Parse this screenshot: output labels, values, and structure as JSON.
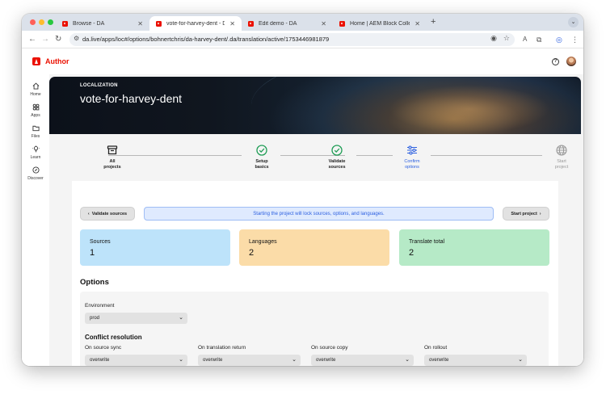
{
  "browser": {
    "tabs": [
      {
        "label": "Browse - DA",
        "active": false
      },
      {
        "label": "vote-for-harvey-dent - DA Tr",
        "active": true
      },
      {
        "label": "Edit demo - DA",
        "active": false
      },
      {
        "label": "Home | AEM Block Collection",
        "active": false
      }
    ],
    "url": "da.live/apps/loc#/options/bohnertchris/da-harvey-dent/.da/translation/active/1753446981879",
    "traffic_colors": [
      "#ff5f57",
      "#febc2e",
      "#28c840"
    ]
  },
  "app": {
    "name": "Author",
    "brand_color": "#eb1000"
  },
  "rail": {
    "items": [
      {
        "label": "Home",
        "icon": "home-icon"
      },
      {
        "label": "Apps",
        "icon": "apps-icon"
      },
      {
        "label": "Files",
        "icon": "folder-icon"
      },
      {
        "label": "Learn",
        "icon": "lightbulb-icon"
      },
      {
        "label": "Discover",
        "icon": "compass-icon"
      }
    ]
  },
  "hero": {
    "kicker": "LOCALIZATION",
    "title": "vote-for-harvey-dent"
  },
  "steps": [
    {
      "label": "All\nprojects",
      "icon": "inbox-icon",
      "state": "done"
    },
    {
      "label": "Setup\nbasics",
      "icon": "check-circle-icon",
      "state": "done"
    },
    {
      "label": "Validate\nsources",
      "icon": "check-circle-icon",
      "state": "done"
    },
    {
      "label": "Confirm\noptions",
      "icon": "sliders-icon",
      "state": "current"
    },
    {
      "label": "Start\nproject",
      "icon": "globe-icon",
      "state": "pending"
    }
  ],
  "actions": {
    "back_label": "Validate sources",
    "notice": "Starting the project will lock sources, options, and languages.",
    "next_label": "Start project"
  },
  "stats": [
    {
      "title": "Sources",
      "value": "1",
      "color": "#bde3fa"
    },
    {
      "title": "Languages",
      "value": "2",
      "color": "#fbdca8"
    },
    {
      "title": "Translate total",
      "value": "2",
      "color": "#b6eac7"
    }
  ],
  "options": {
    "title": "Options",
    "environment": {
      "label": "Environment",
      "value": "prod"
    },
    "conflict": {
      "title": "Conflict resolution",
      "fields": [
        {
          "label": "On source sync",
          "value": "overwrite"
        },
        {
          "label": "On translation return",
          "value": "overwrite"
        },
        {
          "label": "On source copy",
          "value": "overwrite"
        },
        {
          "label": "On rollout",
          "value": "overwrite"
        }
      ]
    }
  },
  "colors": {
    "step_done": "#1f9d55",
    "step_current": "#2b5fe0",
    "step_pending": "#9a9a9a"
  }
}
